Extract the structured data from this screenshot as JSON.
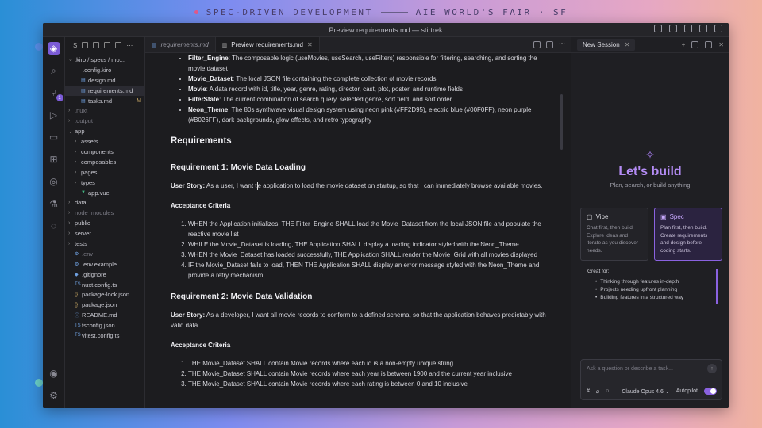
{
  "banner": {
    "left": "SPEC-DRIVEN DEVELOPMENT",
    "right": "AIE WORLD'S FAIR · SF"
  },
  "window": {
    "title": "Preview requirements.md — stirtrek"
  },
  "activity_badge": "1",
  "explorer": {
    "header": "S",
    "rows": [
      {
        "label": ".kiro / specs / mo...",
        "chev": "⌄",
        "icon": "",
        "indent": 4
      },
      {
        "label": ".config.kiro",
        "chev": "",
        "icon": "",
        "indent": 14
      },
      {
        "label": "design.md",
        "chev": "",
        "icon": "▤",
        "indent": 12
      },
      {
        "label": "requirements.md",
        "chev": "",
        "icon": "▤",
        "indent": 12,
        "selected": true
      },
      {
        "label": "tasks.md",
        "chev": "",
        "icon": "▤",
        "indent": 12,
        "mark": "M"
      },
      {
        "label": ".nuxt",
        "chev": "›",
        "icon": "",
        "indent": 4,
        "dim": true
      },
      {
        "label": ".output",
        "chev": "›",
        "icon": "",
        "indent": 4,
        "dim": true
      },
      {
        "label": "app",
        "chev": "⌄",
        "icon": "",
        "indent": 4
      },
      {
        "label": "assets",
        "chev": "›",
        "icon": "",
        "indent": 12
      },
      {
        "label": "components",
        "chev": "›",
        "icon": "",
        "indent": 12
      },
      {
        "label": "composables",
        "chev": "›",
        "icon": "",
        "indent": 12
      },
      {
        "label": "pages",
        "chev": "›",
        "icon": "",
        "indent": 12
      },
      {
        "label": "types",
        "chev": "›",
        "icon": "",
        "indent": 12
      },
      {
        "label": "app.vue",
        "chev": "",
        "icon": "▼",
        "indent": 12
      },
      {
        "label": "data",
        "chev": "›",
        "icon": "",
        "indent": 4
      },
      {
        "label": "node_modules",
        "chev": "›",
        "icon": "",
        "indent": 4,
        "dim": true
      },
      {
        "label": "public",
        "chev": "›",
        "icon": "",
        "indent": 4
      },
      {
        "label": "server",
        "chev": "›",
        "icon": "",
        "indent": 4
      },
      {
        "label": "tests",
        "chev": "›",
        "icon": "",
        "indent": 4
      },
      {
        "label": ".env",
        "chev": "",
        "icon": "⚙",
        "indent": 4,
        "dim": true
      },
      {
        "label": ".env.example",
        "chev": "",
        "icon": "⚙",
        "indent": 4
      },
      {
        "label": ".gitignore",
        "chev": "",
        "icon": "◆",
        "indent": 4
      },
      {
        "label": "nuxt.config.ts",
        "chev": "",
        "icon": "TS",
        "indent": 4
      },
      {
        "label": "package-lock.json",
        "chev": "",
        "icon": "{}",
        "indent": 4
      },
      {
        "label": "package.json",
        "chev": "",
        "icon": "{}",
        "indent": 4
      },
      {
        "label": "README.md",
        "chev": "",
        "icon": "ⓘ",
        "indent": 4
      },
      {
        "label": "tsconfig.json",
        "chev": "",
        "icon": "TS",
        "indent": 4
      },
      {
        "label": "vitest.config.ts",
        "chev": "",
        "icon": "TS",
        "indent": 4
      }
    ]
  },
  "editor": {
    "tabs": [
      {
        "label": "requirements.md",
        "active": false
      },
      {
        "label": "Preview requirements.md",
        "active": true
      }
    ],
    "glossary": [
      {
        "term": "Filter_Engine",
        "desc": ": The composable logic (useMovies, useSearch, useFilters) responsible for filtering, searching, and sorting the movie dataset"
      },
      {
        "term": "Movie_Dataset",
        "desc": ": The local JSON file containing the complete collection of movie records"
      },
      {
        "term": "Movie",
        "desc": ": A data record with id, title, year, genre, rating, director, cast, plot, poster, and runtime fields"
      },
      {
        "term": "FilterState",
        "desc": ": The current combination of search query, selected genre, sort field, and sort order"
      },
      {
        "term": "Neon_Theme",
        "desc": ": The 80s synthwave visual design system using neon pink (#FF2D95), electric blue (#00F0FF), neon purple (#B026FF), dark backgrounds, glow effects, and retro typography"
      }
    ],
    "h_requirements": "Requirements",
    "req1": {
      "title": "Requirement 1: Movie Data Loading",
      "story_label": "User Story:",
      "story_pre": " As a user, I want t",
      "story_post": "e application to load the movie dataset on startup, so that I can immediately browse available movies.",
      "criteria_label": "Acceptance Criteria",
      "criteria": [
        "WHEN the Application initializes, THE Filter_Engine SHALL load the Movie_Dataset from the local JSON file and populate the reactive movie list",
        "WHILE the Movie_Dataset is loading, THE Application SHALL display a loading indicator styled with the Neon_Theme",
        "WHEN the Movie_Dataset has loaded successfully, THE Application SHALL render the Movie_Grid with all movies displayed",
        "IF the Movie_Dataset fails to load, THEN THE Application SHALL display an error message styled with the Neon_Theme and provide a retry mechanism"
      ]
    },
    "req2": {
      "title": "Requirement 2: Movie Data Validation",
      "story_label": "User Story:",
      "story": " As a developer, I want all movie records to conform to a defined schema, so that the application behaves predictably with valid data.",
      "criteria_label": "Acceptance Criteria",
      "criteria": [
        "THE Movie_Dataset SHALL contain Movie records where each id is a non-empty unique string",
        "THE Movie_Dataset SHALL contain Movie records where each year is between 1900 and the current year inclusive",
        "THE Movie_Dataset SHALL contain Movie records where each rating is between 0 and 10 inclusive"
      ]
    }
  },
  "chat": {
    "tab": "New Session",
    "hero_title": "Let's build",
    "hero_sub": "Plan, search, or build anything",
    "modes": [
      {
        "name": "Vibe",
        "desc": "Chat first, then build. Explore ideas and iterate as you discover needs.",
        "active": false
      },
      {
        "name": "Spec",
        "desc": "Plan first, then build. Create requirements and design before coding starts.",
        "active": true
      }
    ],
    "great_for": "Great for:",
    "great_items": [
      "Thinking through features in-depth",
      "Projects needing upfront planning",
      "Building features in a structured way"
    ],
    "composer_placeholder": "Ask a question or describe a task...",
    "model": "Claude Opus 4.6",
    "autopilot": "Autopilot"
  }
}
